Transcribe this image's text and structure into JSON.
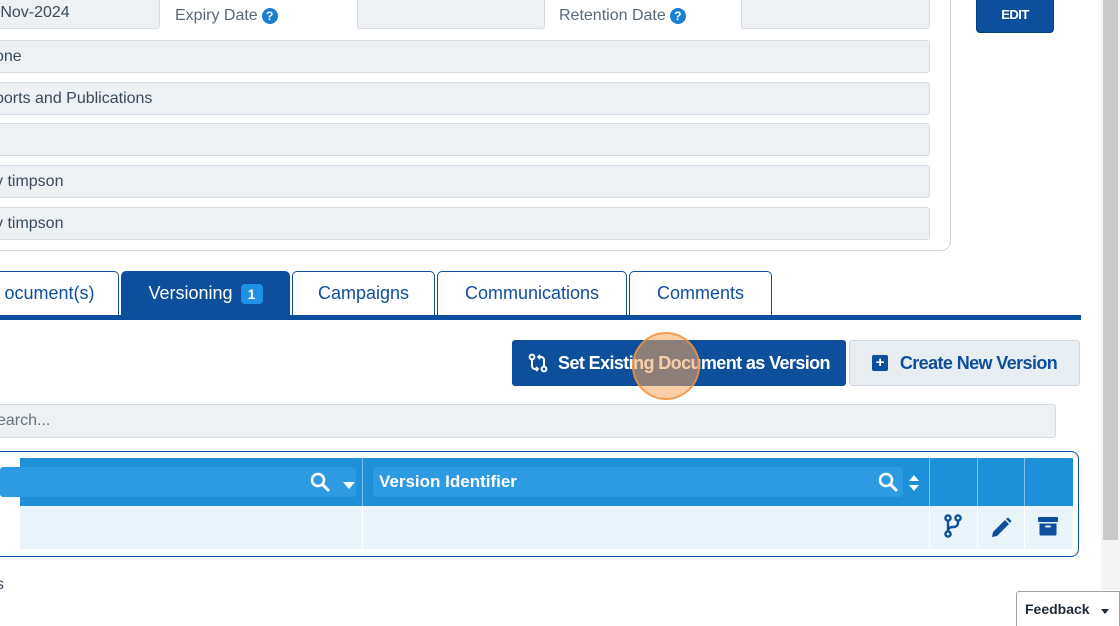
{
  "details": {
    "row1": {
      "date_value": "-Nov-2024",
      "expiry_label": "Expiry Date",
      "expiry_value": "",
      "retention_label": "Retention Date",
      "retention_value": ""
    },
    "fields": [
      "one",
      "ports and Publications",
      "",
      "y timpson",
      "y timpson"
    ],
    "help_glyph": "?",
    "edit_label": "EDIT"
  },
  "tabs": [
    {
      "label": "ocument(s)",
      "active": false
    },
    {
      "label": "Versioning",
      "badge": "1",
      "active": true
    },
    {
      "label": "Campaigns",
      "active": false
    },
    {
      "label": "Communications",
      "active": false
    },
    {
      "label": "Comments",
      "active": false
    }
  ],
  "actions": {
    "set_existing_label": "Set Existing Document as Version",
    "create_new_label": "Create New Version"
  },
  "search": {
    "placeholder": "earch..."
  },
  "table": {
    "columns": [
      {
        "label": ""
      },
      {
        "label": "Version Identifier"
      }
    ],
    "rows": [
      {
        "col1": "",
        "col2": ""
      }
    ],
    "row_actions": [
      "branch-icon",
      "pencil-icon",
      "archive-icon"
    ]
  },
  "footer": {
    "text": "s"
  },
  "feedback": {
    "label": "Feedback"
  },
  "colors": {
    "primary": "#0d4f9c",
    "header_blue": "#1e8fd9",
    "row_bg": "#e9f4fb",
    "field_bg": "#eef1f4",
    "click_indicator": "#f6a65d"
  }
}
